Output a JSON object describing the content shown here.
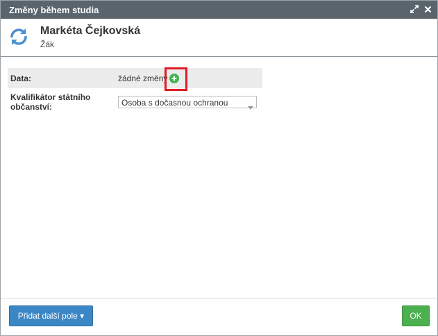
{
  "dialog": {
    "title": "Změny během studia",
    "controls": {
      "expand_icon": "expand-icon",
      "close_icon": "close-icon"
    }
  },
  "header": {
    "avatar_icon": "refresh-arrows-icon",
    "name": "Markéta Čejkovská",
    "role": "Žák"
  },
  "fields": {
    "data": {
      "label": "Data:",
      "value": "žádné změny",
      "add_icon": "plus-circle-icon"
    },
    "kvalifikator": {
      "label": "Kvalifikátor státního občanství:",
      "selected": "Osoba s dočasnou ochranou"
    }
  },
  "footer": {
    "add_field_label": "Přidat další pole ▾",
    "ok_label": "OK"
  },
  "colors": {
    "titlebar": "#5a646c",
    "primary": "#3b87c6",
    "success": "#4caf50",
    "add": "#3fb34f",
    "highlight": "#e01b24"
  }
}
